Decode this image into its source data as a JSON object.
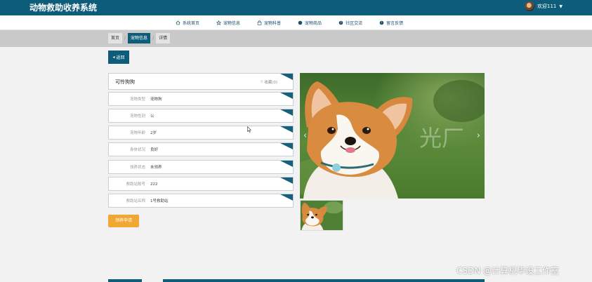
{
  "app": {
    "title": "动物救助收养系统"
  },
  "user": {
    "greeting": "欢迎111",
    "caret": "▼"
  },
  "nav": {
    "items": [
      {
        "label": "系统首页",
        "icon": "home-icon"
      },
      {
        "label": "宠物信息",
        "icon": "star-icon"
      },
      {
        "label": "宠物科普",
        "icon": "bag-icon"
      },
      {
        "label": "宠物商品",
        "icon": "circle-icon"
      },
      {
        "label": "社区交流",
        "icon": "help-icon"
      },
      {
        "label": "留言反馈",
        "icon": "info-icon"
      }
    ]
  },
  "breadcrumb": {
    "home": "首页",
    "section": "宠物信息",
    "current": "详情",
    "separator": "/"
  },
  "back_button": {
    "icon": "◂",
    "label": "返回"
  },
  "pet": {
    "name": "可怜狗狗",
    "favorite": {
      "icon": "☆",
      "label": "收藏(0)"
    },
    "fields": [
      {
        "label": "宠物类型",
        "value": "宠物狗"
      },
      {
        "label": "宠物性别",
        "value": "公"
      },
      {
        "label": "宠物年龄",
        "value": "2岁"
      },
      {
        "label": "身体状况",
        "value": "良好"
      },
      {
        "label": "领养状态",
        "value": "未领养"
      },
      {
        "label": "救助站账号",
        "value": "222"
      },
      {
        "label": "救助站名称",
        "value": "1号救助站"
      }
    ]
  },
  "adopt_button": {
    "label": "领养申请"
  },
  "carousel": {
    "prev": "‹",
    "next": "›",
    "overlay_text": "光厂"
  },
  "watermark": "CSDN @计算机毕设工作室",
  "colors": {
    "primary": "#0c5c7a",
    "accent": "#f0a733",
    "background": "#f2f2f2"
  }
}
